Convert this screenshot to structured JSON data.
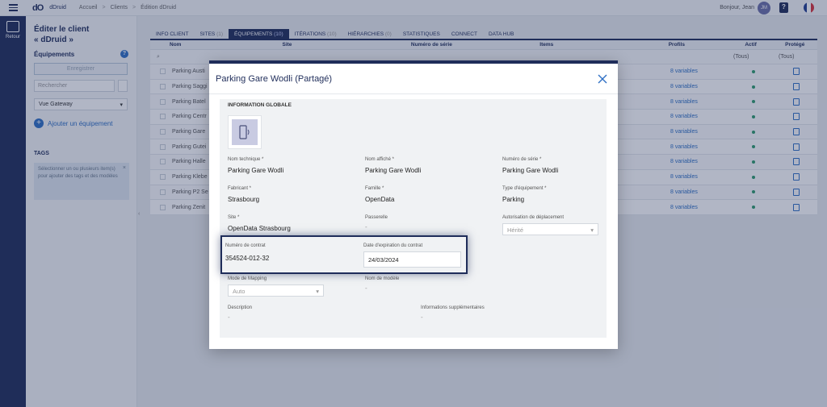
{
  "topbar": {
    "app_name": "dDruid",
    "breadcrumbs": [
      "Accueil",
      "Clients",
      "Édition dDruid"
    ],
    "greeting": "Bonjour, Jean",
    "avatar_initials": "JM"
  },
  "rail": {
    "back_label": "Retour"
  },
  "panel": {
    "title_line1": "Éditer le client",
    "title_line2": "« dDruid »",
    "section": "Équipements",
    "save_label": "Enregistrer",
    "search_placeholder": "Rechercher",
    "view_select": "Vue Gateway",
    "add_label": "Ajouter un équipement",
    "tags_title": "TAGS",
    "tags_hint": "Sélectionner un ou plusieurs item(s) pour ajouter des tags et des modèles"
  },
  "tabs": [
    {
      "label": "INFO CLIENT",
      "count": ""
    },
    {
      "label": "SITES",
      "count": "(1)"
    },
    {
      "label": "ÉQUIPEMENTS",
      "count": "(10)"
    },
    {
      "label": "ITÉRATIONS",
      "count": "(10)"
    },
    {
      "label": "HIÉRARCHIES",
      "count": "(0)"
    },
    {
      "label": "STATISTIQUES",
      "count": ""
    },
    {
      "label": "CONNECT",
      "count": ""
    },
    {
      "label": "DATA HUB",
      "count": ""
    }
  ],
  "table": {
    "headers": [
      "Nom",
      "Site",
      "Numéro de série",
      "Items",
      "Profils",
      "Actif",
      "Protégé"
    ],
    "filter_all": "(Tous)",
    "rows": [
      {
        "name": "Parking Austi",
        "profils": "8 variables"
      },
      {
        "name": "Parking Saggi",
        "profils": "8 variables"
      },
      {
        "name": "Parking Batel",
        "profils": "8 variables"
      },
      {
        "name": "Parking Centr",
        "profils": "8 variables"
      },
      {
        "name": "Parking Gare",
        "profils": "8 variables"
      },
      {
        "name": "Parking Gutei",
        "profils": "8 variables"
      },
      {
        "name": "Parking Halle",
        "profils": "8 variables"
      },
      {
        "name": "Parking Klebe",
        "profils": "8 variables"
      },
      {
        "name": "Parking P2 Se",
        "profils": "8 variables"
      },
      {
        "name": "Parking Zenit",
        "profils": "8 variables"
      }
    ]
  },
  "modal": {
    "title": "Parking Gare Wodli (Partagé)",
    "section": "INFORMATION GLOBALE",
    "fields": {
      "nom_technique_label": "Nom technique *",
      "nom_technique": "Parking Gare Wodli",
      "nom_affiche_label": "Nom affiché *",
      "nom_affiche": "Parking Gare Wodli",
      "numero_serie_label": "Numéro de série *",
      "numero_serie": "Parking Gare Wodli",
      "fabricant_label": "Fabricant *",
      "fabricant": "Strasbourg",
      "famille_label": "Famille *",
      "famille": "OpenData",
      "type_label": "Type d'équipement *",
      "type": "Parking",
      "site_label": "Site *",
      "site": "OpenData Strasbourg",
      "passerelle_label": "Passerelle",
      "passerelle": "-",
      "autorisation_label": "Autorisation de déplacement",
      "autorisation": "Hérité",
      "contrat_label": "Numéro de contrat",
      "contrat": "354524-012-32",
      "expiration_label": "Date d'expiration du contrat",
      "expiration": "24/03/2024",
      "mapping_label": "Mode de Mapping",
      "mapping": "Auto",
      "modele_label": "Nom de modèle",
      "modele": "-",
      "description_label": "Description",
      "description": "-",
      "infos_label": "Informations supplémentaires",
      "infos": "-"
    }
  },
  "colors": {
    "brand": "#1f2d5a",
    "accent": "#2e6fc4",
    "active": "#2e9b6e"
  }
}
